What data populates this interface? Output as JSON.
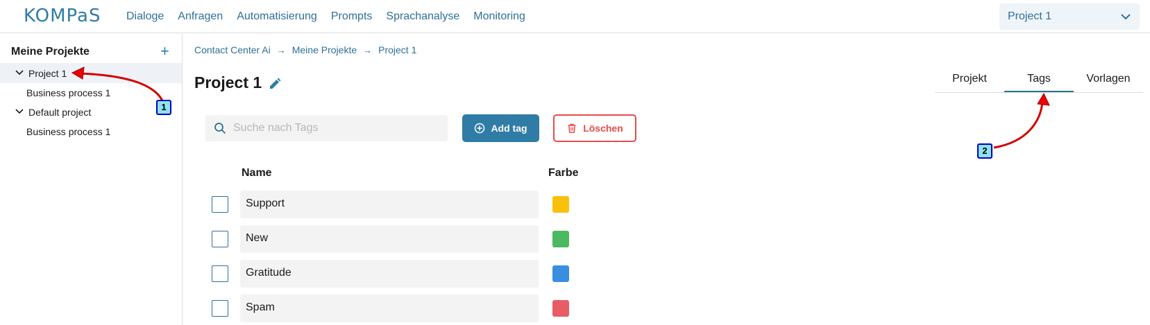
{
  "header": {
    "logo": "KOMPaS",
    "nav": [
      "Dialoge",
      "Anfragen",
      "Automatisierung",
      "Prompts",
      "Sprachanalyse",
      "Monitoring"
    ],
    "project_selector": "Project 1"
  },
  "sidebar": {
    "title": "Meine Projekte",
    "tree": [
      {
        "label": "Project 1",
        "children": [
          "Business process 1"
        ]
      },
      {
        "label": "Default project",
        "children": [
          "Business process 1"
        ]
      }
    ]
  },
  "breadcrumb": [
    "Contact Center Ai",
    "Meine Projekte",
    "Project 1"
  ],
  "page_title": "Project 1",
  "tabs": [
    "Projekt",
    "Tags",
    "Vorlagen"
  ],
  "active_tab": "Tags",
  "search": {
    "placeholder": "Suche nach Tags",
    "value": ""
  },
  "actions": {
    "add_tag": "Add tag",
    "delete": "Löschen"
  },
  "table": {
    "columns": [
      "Name",
      "Farbe"
    ],
    "rows": [
      {
        "name": "Support",
        "color": "#f9c00c"
      },
      {
        "name": "New",
        "color": "#4cb860"
      },
      {
        "name": "Gratitude",
        "color": "#3a8ee0"
      },
      {
        "name": "Spam",
        "color": "#e85c66"
      }
    ]
  },
  "annotations": [
    "1",
    "2"
  ],
  "colors": {
    "accent": "#2f7ca6",
    "danger": "#e84a4a"
  }
}
